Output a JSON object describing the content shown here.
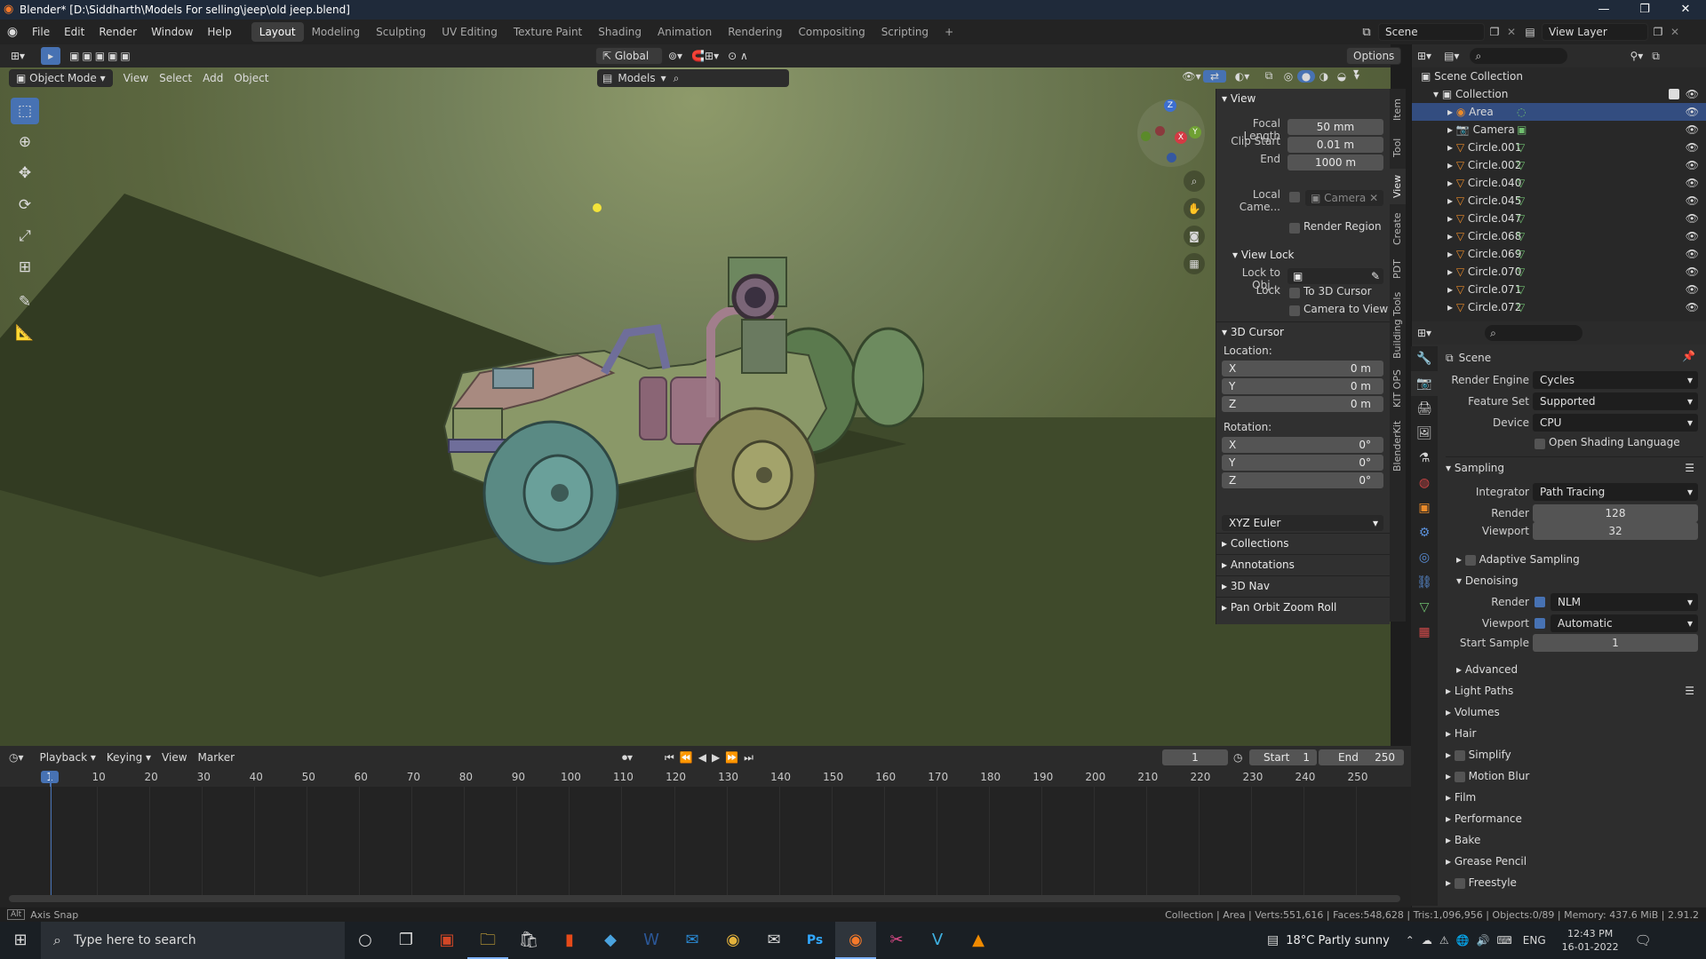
{
  "titlebar": {
    "title": "Blender* [D:\\Siddharth\\Models For selling\\jeep\\old jeep.blend]"
  },
  "menu": {
    "items": [
      "File",
      "Edit",
      "Render",
      "Window",
      "Help"
    ]
  },
  "workspaces": [
    "Layout",
    "Modeling",
    "Sculpting",
    "UV Editing",
    "Texture Paint",
    "Shading",
    "Animation",
    "Rendering",
    "Compositing",
    "Scripting"
  ],
  "scene": {
    "label": "Scene",
    "view_layer": "View Layer"
  },
  "viewport": {
    "mode": "Object Mode",
    "menus": [
      "View",
      "Select",
      "Add",
      "Object"
    ],
    "orientation": "Global",
    "options": "Options",
    "collection_filter": "Models",
    "gizmo": {
      "x": "X",
      "y": "Y",
      "z": "Z"
    }
  },
  "npanel": {
    "tabs": [
      "Item",
      "Tool",
      "View",
      "Create",
      "PDT",
      "Building Tools",
      "KIT OPS",
      "BlenderKit"
    ],
    "view": {
      "title": "View",
      "focal_label": "Focal Length",
      "focal": "50 mm",
      "clip_start_label": "Clip Start",
      "clip_start": "0.01 m",
      "end_label": "End",
      "end": "1000 m",
      "local_cam_label": "Local Came...",
      "local_cam": "Camera",
      "render_region": "Render Region"
    },
    "view_lock": {
      "title": "View Lock",
      "lock_obj_label": "Lock to Obj...",
      "lock_label": "Lock",
      "to_cursor": "To 3D Cursor",
      "cam_to_view": "Camera to View"
    },
    "cursor": {
      "title": "3D Cursor",
      "location_label": "Location:",
      "x": "0 m",
      "y": "0 m",
      "z": "0 m",
      "rotation_label": "Rotation:",
      "rx": "0°",
      "ry": "0°",
      "rz": "0°",
      "mode": "XYZ Euler",
      "ax": "X",
      "ay": "Y",
      "az": "Z"
    },
    "sections": [
      "Collections",
      "Annotations",
      "3D Nav",
      "Pan Orbit Zoom Roll"
    ]
  },
  "outliner": {
    "scene_collection": "Scene Collection",
    "collection": "Collection",
    "items": [
      "Area",
      "Camera",
      "Circle.001",
      "Circle.002",
      "Circle.040",
      "Circle.045",
      "Circle.047",
      "Circle.068",
      "Circle.069",
      "Circle.070",
      "Circle.071",
      "Circle.072"
    ]
  },
  "properties": {
    "scene_label": "Scene",
    "render_engine_label": "Render Engine",
    "render_engine": "Cycles",
    "feature_set_label": "Feature Set",
    "feature_set": "Supported",
    "device_label": "Device",
    "device": "CPU",
    "osl": "Open Shading Language",
    "sampling": "Sampling",
    "integrator_label": "Integrator",
    "integrator": "Path Tracing",
    "render_label": "Render",
    "render_samples": "128",
    "viewport_label": "Viewport",
    "viewport_samples": "32",
    "adaptive": "Adaptive Sampling",
    "denoising": "Denoising",
    "den_render_label": "Render",
    "den_render": "NLM",
    "den_viewport_label": "Viewport",
    "den_viewport": "Automatic",
    "start_sample_label": "Start Sample",
    "start_sample": "1",
    "advanced": "Advanced",
    "sections": [
      "Light Paths",
      "Volumes",
      "Hair",
      "Simplify",
      "Motion Blur",
      "Film",
      "Performance",
      "Bake",
      "Grease Pencil",
      "Freestyle"
    ]
  },
  "timeline": {
    "menus": [
      "Playback",
      "Keying",
      "View",
      "Marker"
    ],
    "current_frame": "1",
    "start_label": "Start",
    "start": "1",
    "end_label": "End",
    "end": "250",
    "ticks": [
      "1",
      "10",
      "20",
      "30",
      "40",
      "50",
      "60",
      "70",
      "80",
      "90",
      "100",
      "110",
      "120",
      "130",
      "140",
      "150",
      "160",
      "170",
      "180",
      "190",
      "200",
      "210",
      "220",
      "230",
      "240",
      "250"
    ]
  },
  "status": {
    "left": "Axis Snap",
    "right": "Collection | Area | Verts:551,616 | Faces:548,628 | Tris:1,096,956 | Objects:0/89 | Memory: 437.6 MiB | 2.91.2"
  },
  "taskbar": {
    "search": "Type here to search",
    "weather": "18°C  Partly sunny",
    "lang": "ENG",
    "time": "12:43 PM",
    "date": "16-01-2022"
  }
}
